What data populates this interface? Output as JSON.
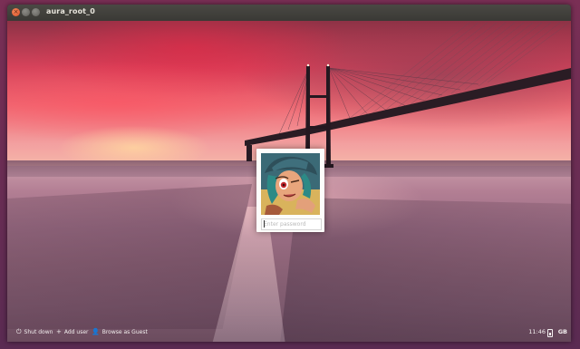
{
  "window": {
    "title": "aura_root_0",
    "close_glyph": "×"
  },
  "login": {
    "password_placeholder": "Enter password"
  },
  "bottom_bar": {
    "shutdown_label": "Shut down",
    "add_user_label": "Add user",
    "guest_label": "Browse as Guest",
    "shutdown_icon": "power-icon",
    "add_user_icon": "plus-icon",
    "guest_icon": "person-icon",
    "time": "11:46",
    "keyboard_layout": "GB"
  },
  "colors": {
    "desktop_bg": "#7a2f55",
    "titlebar": "#3c3b37",
    "close_button": "#e0582f"
  }
}
